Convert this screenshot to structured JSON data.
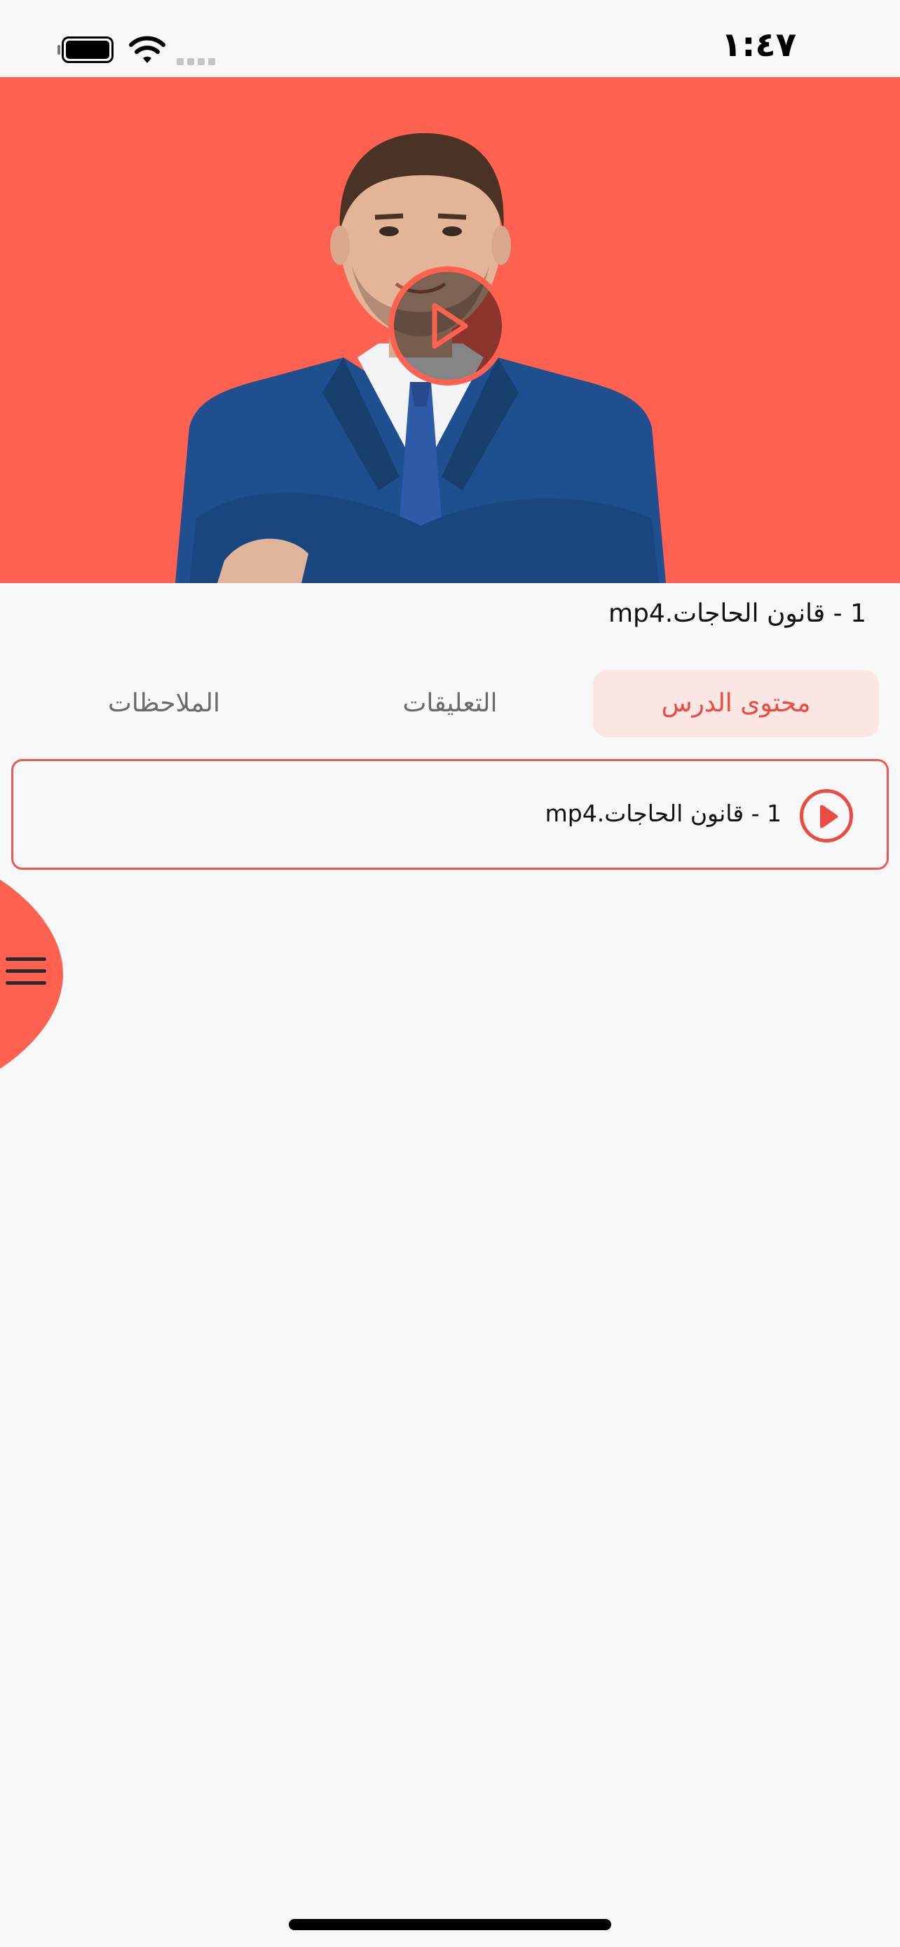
{
  "status_bar": {
    "time": "١:٤٧"
  },
  "video": {
    "title": "1 - قانون الحاجات.mp4"
  },
  "tabs": [
    {
      "label": "محتوى الدرس",
      "selected": true
    },
    {
      "label": "التعليقات",
      "selected": false
    },
    {
      "label": "الملاحظات",
      "selected": false
    }
  ],
  "lesson_items": [
    {
      "label": "1 - قانون الحاجات.mp4"
    }
  ],
  "colors": {
    "accent": "#ff6150",
    "accent_dark": "#ec4b43",
    "tab_selected_bg": "#fbe6e3",
    "background": "#f8f8f8"
  },
  "icons": {
    "battery": "battery-icon",
    "wifi": "wifi-icon",
    "play": "play-icon",
    "menu": "hamburger-menu-icon"
  }
}
